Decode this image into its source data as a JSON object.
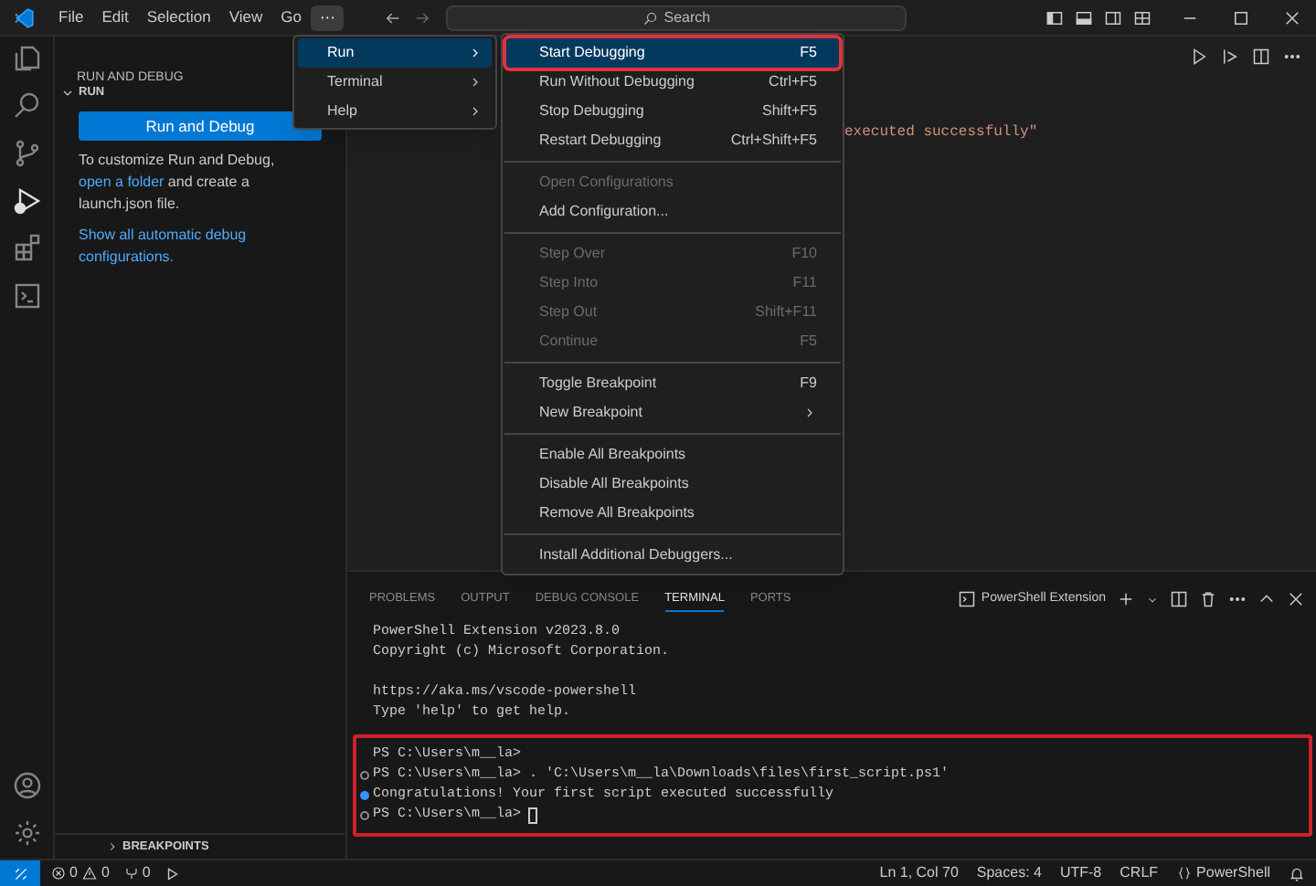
{
  "menu_bar": [
    {
      "label": "File",
      "selected": false
    },
    {
      "label": "Edit",
      "selected": false
    },
    {
      "label": "Selection",
      "selected": false
    },
    {
      "label": "View",
      "selected": false
    },
    {
      "label": "Go",
      "selected": false
    },
    {
      "label": "···",
      "selected": true
    }
  ],
  "search": {
    "placeholder": "Search"
  },
  "sidebar": {
    "title": "RUN AND DEBUG",
    "section": "RUN",
    "button": "Run and Debug",
    "text_before": "To customize Run and Debug,",
    "link": "open a folder",
    "text_after": "and create a launch.json file.",
    "link_2": "Show all automatic debug configurations.",
    "footer_section": "BREAKPOINTS"
  },
  "menu": [
    {
      "label": "Run",
      "selected": true
    },
    {
      "label": "Terminal",
      "selected": false
    },
    {
      "label": "Help",
      "selected": false
    }
  ],
  "submenu": [
    [
      {
        "label": "Start Debugging",
        "shortcut": "F5",
        "disabled": false,
        "selected": true,
        "highlight_box": true
      },
      {
        "label": "Run Without Debugging",
        "shortcut": "Ctrl+F5",
        "disabled": false,
        "selected": false,
        "highlight_box": false
      },
      {
        "label": "Stop Debugging",
        "shortcut": "Shift+F5",
        "disabled": false,
        "selected": false,
        "highlight_box": false
      },
      {
        "label": "Restart Debugging",
        "shortcut": "Ctrl+Shift+F5",
        "disabled": false,
        "selected": false,
        "highlight_box": false
      }
    ],
    [
      {
        "label": "Open Configurations",
        "disabled": true,
        "selected": false,
        "highlight_box": false
      },
      {
        "label": "Add Configuration...",
        "disabled": false,
        "selected": false,
        "highlight_box": false
      }
    ],
    [
      {
        "label": "Step Over",
        "shortcut": "F10",
        "disabled": true,
        "selected": false,
        "highlight_box": false
      },
      {
        "label": "Step Into",
        "shortcut": "F11",
        "disabled": true,
        "selected": false,
        "highlight_box": false
      },
      {
        "label": "Step Out",
        "shortcut": "Shift+F11",
        "disabled": true,
        "selected": false,
        "highlight_box": false
      },
      {
        "label": "Continue",
        "shortcut": "F5",
        "disabled": true,
        "selected": false,
        "highlight_box": false
      }
    ],
    [
      {
        "label": "Toggle Breakpoint",
        "shortcut": "F9",
        "disabled": false,
        "selected": false,
        "highlight_box": false
      },
      {
        "label": "New Breakpoint",
        "submenu": true,
        "disabled": false,
        "selected": false,
        "highlight_box": false
      }
    ],
    [
      {
        "label": "Enable All Breakpoints",
        "disabled": false,
        "selected": false,
        "highlight_box": false
      },
      {
        "label": "Disable All Breakpoints",
        "disabled": false,
        "selected": false,
        "highlight_box": false
      },
      {
        "label": "Remove All Breakpoints",
        "disabled": false,
        "selected": false,
        "highlight_box": false
      }
    ],
    [
      {
        "label": "Install Additional Debuggers...",
        "disabled": false,
        "selected": false,
        "highlight_box": false
      }
    ]
  ],
  "editor": {
    "code_fragment": "executed successfully\""
  },
  "panel": {
    "tabs": [
      {
        "label": "PROBLEMS",
        "selected": false
      },
      {
        "label": "OUTPUT",
        "selected": false
      },
      {
        "label": "DEBUG CONSOLE",
        "selected": false
      },
      {
        "label": "TERMINAL",
        "selected": true
      },
      {
        "label": "PORTS",
        "selected": false
      }
    ],
    "terminal_name": "PowerShell Extension",
    "intro": [
      [
        "PowerShell Extension v2023.8.0",
        "Copyright (c) Microsoft Corporation."
      ],
      [
        "https://aka.ms/vscode-powershell",
        "Type 'help' to get help."
      ]
    ],
    "session": {
      "highlight_box": true,
      "lines": [
        {
          "text": "PS C:\\Users\\m__la>",
          "kind": "plain",
          "cursor": false
        },
        {
          "text": "PS C:\\Users\\m__la> . 'C:\\Users\\m__la\\Downloads\\files\\first_script.ps1'",
          "kind": "circle",
          "cursor": false
        },
        {
          "text": "Congratulations! Your first script executed successfully",
          "kind": "dot",
          "cursor": false
        },
        {
          "text": "PS C:\\Users\\m__la>",
          "kind": "circle",
          "cursor": true
        }
      ]
    }
  },
  "status_bar": {
    "errors": "0",
    "warnings": "0",
    "ports": "0",
    "right": [
      "Ln 1, Col 70",
      "Spaces: 4",
      "UTF-8",
      "CRLF"
    ],
    "language": "PowerShell"
  }
}
